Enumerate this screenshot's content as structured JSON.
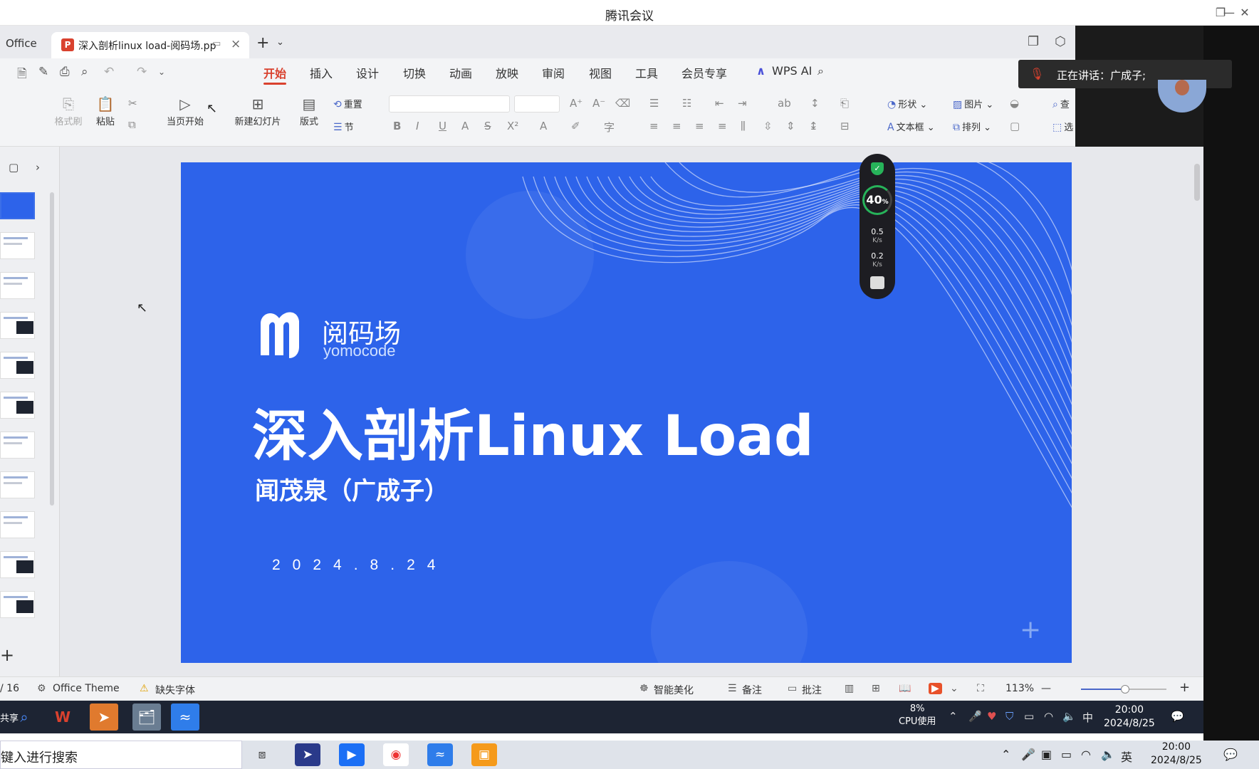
{
  "window": {
    "title": "腾讯会议",
    "minimize": "—",
    "restore": "❐",
    "close": "✕"
  },
  "tabs": {
    "office_tab": "Office",
    "document_tab": {
      "label": "深入剖析linux load-阅码场.pp",
      "icon_letter": "P"
    },
    "add_label": "+",
    "more_label": "⌄"
  },
  "menu": {
    "items": [
      "开始",
      "插入",
      "设计",
      "切换",
      "动画",
      "放映",
      "审阅",
      "视图",
      "工具",
      "会员专享"
    ],
    "active": "开始",
    "wps_ai": "WPS AI"
  },
  "ribbon": {
    "format_painter": "格式刷",
    "paste": "粘贴",
    "play_from_current": "当页开始",
    "new_slide": "新建幻灯片",
    "layout": "版式",
    "reset": "重置",
    "section": "节",
    "shape": "形状",
    "picture": "图片",
    "textbox": "文本框",
    "arrange": "排列",
    "find": "查",
    "select": "选"
  },
  "meeting": {
    "speaking_label": "正在讲话：",
    "speaker_name": "广成子;"
  },
  "slide": {
    "brand_cn": "阅码场",
    "brand_en": "yomocode",
    "title": "深入剖析Linux Load",
    "subtitle": "闻茂泉（广成子）",
    "date": "2024.8.24"
  },
  "net_widget": {
    "percent": "40",
    "percent_sign": "%",
    "upload": "0.5",
    "download": "0.2",
    "unit": "K/s"
  },
  "status": {
    "page": "/ 16",
    "theme": "Office Theme",
    "missing_font": "缺失字体",
    "beautify": "智能美化",
    "notes": "备注",
    "comments": "批注",
    "zoom": "113%",
    "zoom_level": 0.52
  },
  "inner_taskbar": {
    "share_label": "共享",
    "cpu_percent": "8%",
    "cpu_label": "CPU使用",
    "ime": "中",
    "time": "20:00",
    "date": "2024/8/25"
  },
  "local_taskbar": {
    "search_placeholder": "键入进行搜索",
    "ime": "英",
    "time": "20:00",
    "date": "2024/8/25"
  }
}
